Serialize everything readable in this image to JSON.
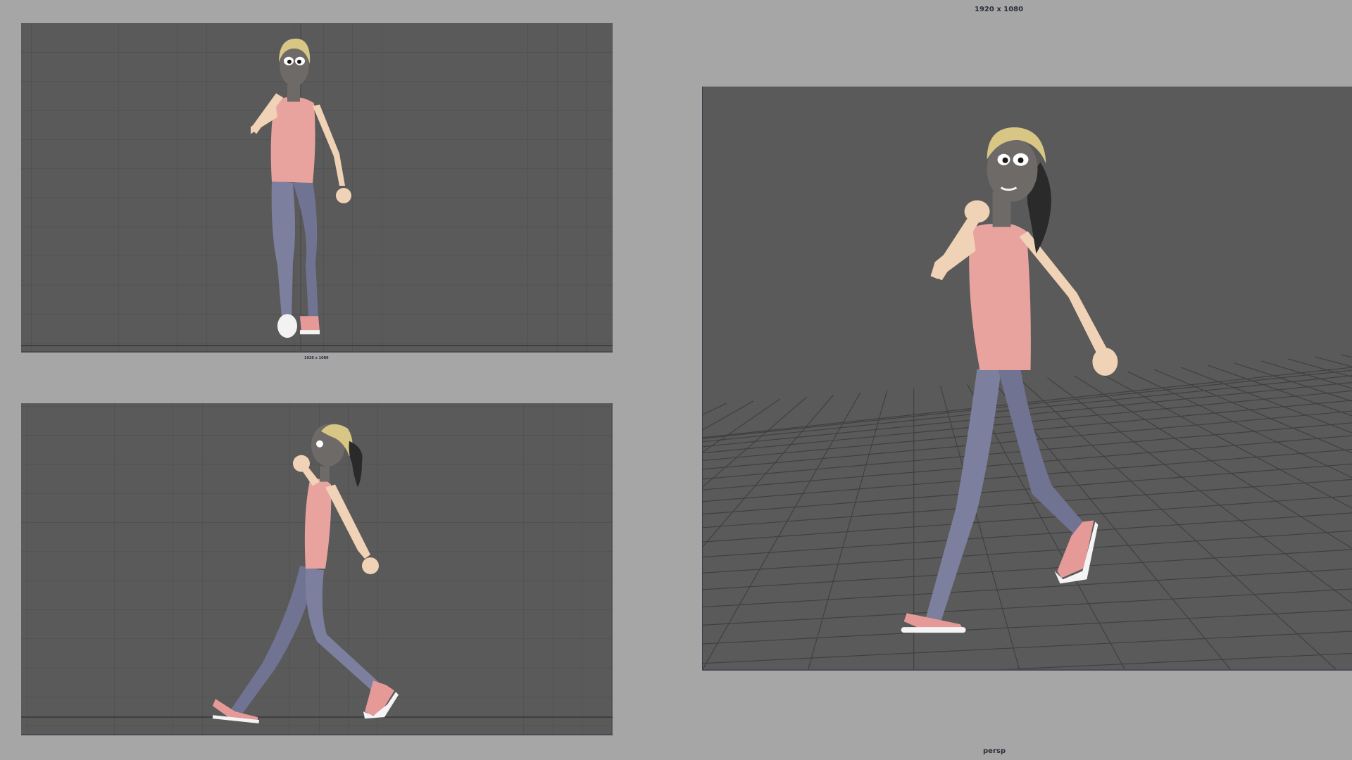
{
  "app": {
    "resolution_gate_label": "1920 x 1080",
    "front_view_resolution_label": "1920 x 1080",
    "persp_camera_label": "persp"
  },
  "colors": {
    "background": "#a6a6a6",
    "viewport_bg": "#5a5a5a",
    "grid_line": "#4b4b4b",
    "shirt": "#e9a39f",
    "jeans": "#7d7f9e",
    "skin": "#f0d2b6",
    "face": "#6e6a67",
    "hair": "#d8c685",
    "ponytail": "#2a2a2a",
    "shoe": "#e59a98",
    "sole": "#f4f4f4"
  },
  "viewports": [
    {
      "name": "front",
      "camera": "front"
    },
    {
      "name": "side",
      "camera": "side"
    },
    {
      "name": "perspective",
      "camera": "persp"
    }
  ]
}
